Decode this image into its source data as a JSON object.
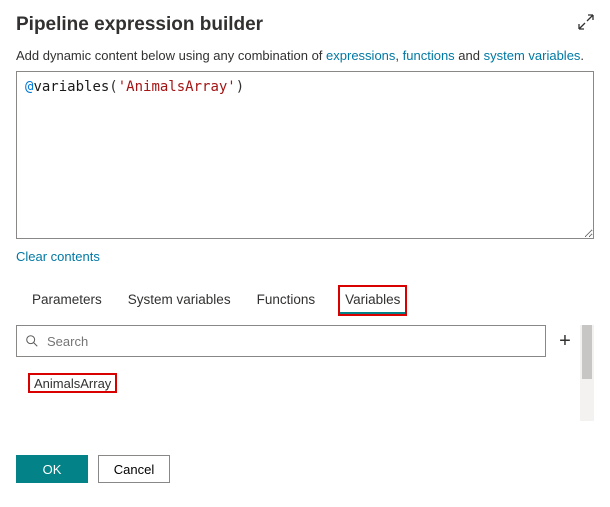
{
  "header": {
    "title": "Pipeline expression builder"
  },
  "hint": {
    "prefix": "Add dynamic content below using any combination of ",
    "link_expressions": "expressions",
    "mid1": ", ",
    "link_functions": "functions",
    "mid2": " and ",
    "link_sysvars": "system variables",
    "suffix": "."
  },
  "editor": {
    "at": "@",
    "fn": "variables",
    "paren_open": "(",
    "str": "'AnimalsArray'",
    "paren_close": ")"
  },
  "clear_label": "Clear contents",
  "tabs": {
    "parameters": "Parameters",
    "system_variables": "System variables",
    "functions": "Functions",
    "variables": "Variables"
  },
  "search": {
    "placeholder": "Search"
  },
  "add_label": "+",
  "variables_list": [
    "AnimalsArray"
  ],
  "footer": {
    "ok": "OK",
    "cancel": "Cancel"
  }
}
